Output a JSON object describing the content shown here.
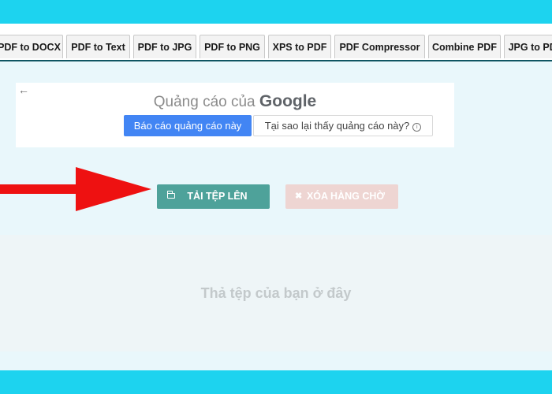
{
  "tabs": [
    {
      "label": "PDF to DOCX"
    },
    {
      "label": "PDF to Text"
    },
    {
      "label": "PDF to JPG"
    },
    {
      "label": "PDF to PNG"
    },
    {
      "label": "XPS to PDF"
    },
    {
      "label": "PDF Compressor"
    },
    {
      "label": "Combine PDF"
    },
    {
      "label": "JPG to PDF"
    }
  ],
  "ad": {
    "back_symbol": "←",
    "title_prefix": "Quảng cáo của",
    "title_brand": "Google",
    "report_button": "Báo cáo quảng cáo này",
    "why_button": "Tại sao lại thấy quảng cáo này?",
    "info_symbol": "i"
  },
  "actions": {
    "upload_label": "TẢI TỆP LÊN",
    "clear_label": "XÓA HÀNG CHỜ",
    "clear_symbol": "✖"
  },
  "dropzone": {
    "text": "Thả tệp của bạn ở đây"
  },
  "colors": {
    "frame": "#1dd3ef",
    "upload_button": "#4ea29a",
    "clear_button": "#eed5d2",
    "arrow": "#ee1111",
    "ad_primary": "#4285f4"
  },
  "icons": {
    "upload": "folder-icon",
    "clear": "close-icon",
    "back": "back-arrow-icon",
    "info": "info-icon"
  }
}
